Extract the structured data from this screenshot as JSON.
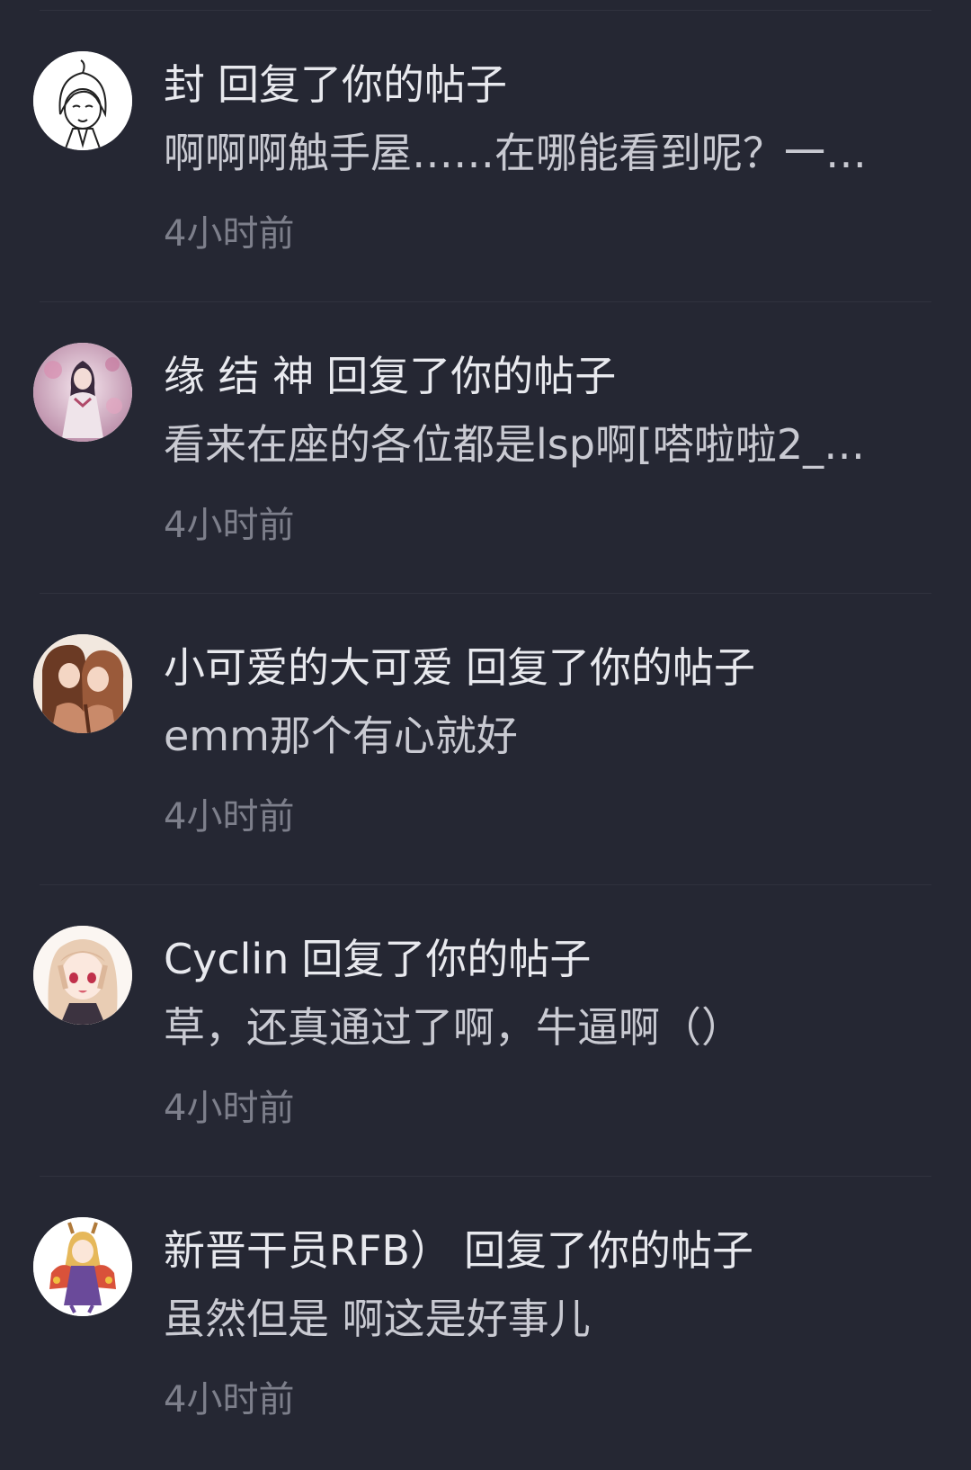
{
  "notifications": [
    {
      "user": "封",
      "action": "回复了你的帖子",
      "preview": "啊啊啊触手屋……在哪能看到呢？一…",
      "time": "4小时前",
      "avatar": "sketch-girl-avatar"
    },
    {
      "user": "缘 结 神",
      "action": "回复了你的帖子",
      "preview": "看来在座的各位都是lsp啊[嗒啦啦2_…",
      "time": "4小时前",
      "avatar": "shrine-girl-avatar"
    },
    {
      "user": "小可爱的大可爱",
      "action": "回复了你的帖子",
      "preview": "emm那个有心就好",
      "time": "4小时前",
      "avatar": "couple-avatar"
    },
    {
      "user": "Cyclin",
      "action": "回复了你的帖子",
      "preview": "草，还真通过了啊，牛逼啊（）",
      "time": "4小时前",
      "avatar": "blonde-girl-avatar"
    },
    {
      "user": "新晋干员RFB）",
      "action": "回复了你的帖子",
      "preview": "虽然但是 啊这是好事儿",
      "time": "4小时前",
      "avatar": "oni-girl-avatar"
    }
  ],
  "colors": {
    "background": "#252733",
    "divider": "#30323e",
    "title": "#e8e9ee",
    "preview": "#c9cad2",
    "time": "#7d7f8b"
  }
}
